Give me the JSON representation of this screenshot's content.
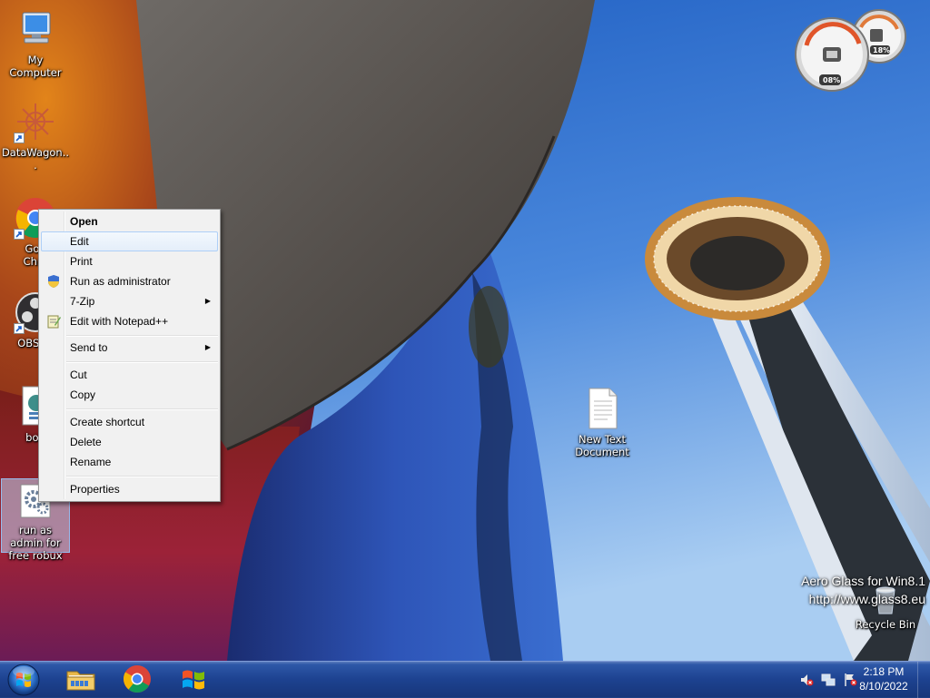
{
  "desktop": {
    "icons": [
      {
        "label": "My Computer",
        "icon": "my-computer-icon"
      },
      {
        "label": "DataWagon...",
        "icon": "datawagon-icon"
      },
      {
        "label": "Goo\nChro",
        "icon": "chrome-icon"
      },
      {
        "label": "OBS St",
        "icon": "obs-icon"
      },
      {
        "label": "bob",
        "icon": "script-file-icon"
      },
      {
        "label": "run as admin for free robux",
        "icon": "gear-file-icon"
      },
      {
        "label": "New Text Document",
        "icon": "text-file-icon"
      },
      {
        "label": "Recycle Bin",
        "icon": "recycle-bin-icon"
      }
    ]
  },
  "context_menu": {
    "items": [
      {
        "label": "Open",
        "bold": true
      },
      {
        "label": "Edit",
        "hover": true
      },
      {
        "label": "Print"
      },
      {
        "label": "Run as administrator",
        "icon": "uac-shield-icon"
      },
      {
        "label": "7-Zip",
        "submenu": true
      },
      {
        "label": "Edit with Notepad++",
        "icon": "notepad-plus-plus-icon"
      },
      {
        "label": "Send to",
        "submenu": true
      },
      {
        "label": "Cut"
      },
      {
        "label": "Copy"
      },
      {
        "label": "Create shortcut"
      },
      {
        "label": "Delete"
      },
      {
        "label": "Rename"
      },
      {
        "label": "Properties"
      }
    ],
    "submenu_arrow": "▶"
  },
  "gadget": {
    "cpu_value": "08%",
    "memory_value": "18%"
  },
  "watermark": {
    "line1": "Aero Glass for Win8.1",
    "line2": "http://www.glass8.eu"
  },
  "taskbar": {
    "apps": [
      {
        "name": "file-explorer-icon"
      },
      {
        "name": "chrome-icon"
      },
      {
        "name": "windows-logo-icon"
      }
    ],
    "tray": {
      "icons": [
        "volume-muted-icon",
        "network-icon",
        "action-center-flag-icon"
      ],
      "time": "2:18 PM",
      "date": "8/10/2022"
    }
  },
  "colors": {
    "sky": "#2f6bc8",
    "taskbar": "#1d4290",
    "menu_bg": "#f1f1f1",
    "menu_hover_border": "#aecff7"
  }
}
